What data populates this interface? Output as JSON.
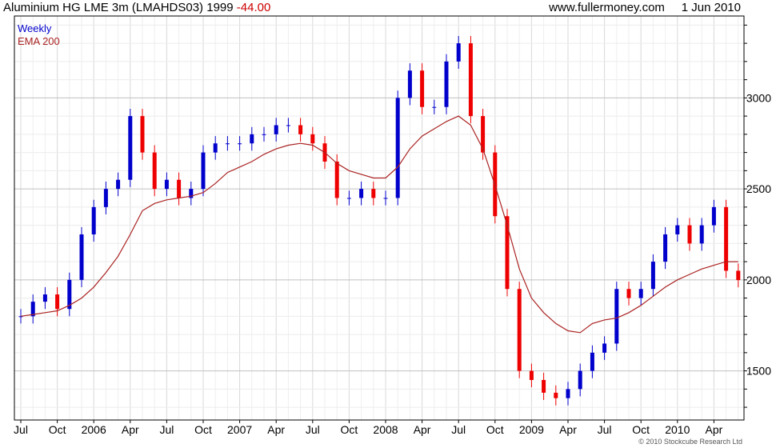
{
  "header": {
    "title": "Aluminium HG LME 3m (LMAHDS03)",
    "last_price": "1999",
    "change": "-44.00",
    "website": "www.fullermoney.com",
    "date": "1 Jun 2010"
  },
  "copyright": "© 2010 Stockcube Research Ltd",
  "colors": {
    "up": "#0000cc",
    "down": "#ee0000",
    "ema": "#aa2222",
    "grid": "#d8d8d8",
    "legend_weekly": "#0000cc",
    "legend_ema": "#aa2222"
  },
  "chart_data": {
    "type": "candlestick",
    "title": "Aluminium HG LME 3m (LMAHDS03)",
    "frequency": "Weekly",
    "ylim": [
      1230,
      3450
    ],
    "y_ticks": [
      1500,
      2000,
      2500,
      3000
    ],
    "x_tick_labels": [
      "Jul",
      "Oct",
      "2006",
      "Apr",
      "Jul",
      "Oct",
      "2007",
      "Apr",
      "Jul",
      "Oct",
      "2008",
      "Apr",
      "Jul",
      "Oct",
      "2009",
      "Apr",
      "Jul",
      "Oct",
      "2010",
      "Apr"
    ],
    "grid": true,
    "legend": {
      "position": "top-left",
      "entries": [
        "Weekly",
        "EMA 200"
      ]
    },
    "series": [
      {
        "name": "Weekly",
        "kind": "close",
        "x": [
          "2005-07",
          "2005-08",
          "2005-09",
          "2005-10",
          "2005-11",
          "2005-12",
          "2006-01",
          "2006-02",
          "2006-03",
          "2006-04",
          "2006-05",
          "2006-06",
          "2006-07",
          "2006-08",
          "2006-09",
          "2006-10",
          "2006-11",
          "2006-12",
          "2007-01",
          "2007-02",
          "2007-03",
          "2007-04",
          "2007-05",
          "2007-06",
          "2007-07",
          "2007-08",
          "2007-09",
          "2007-10",
          "2007-11",
          "2007-12",
          "2008-01",
          "2008-02",
          "2008-03",
          "2008-04",
          "2008-05",
          "2008-06",
          "2008-07",
          "2008-08",
          "2008-09",
          "2008-10",
          "2008-11",
          "2008-12",
          "2009-01",
          "2009-02",
          "2009-03",
          "2009-04",
          "2009-05",
          "2009-06",
          "2009-07",
          "2009-08",
          "2009-09",
          "2009-10",
          "2009-11",
          "2009-12",
          "2010-01",
          "2010-02",
          "2010-03",
          "2010-04",
          "2010-05",
          "2010-06"
        ],
        "values": [
          1800,
          1880,
          1920,
          1840,
          2000,
          2250,
          2400,
          2500,
          2550,
          2900,
          2700,
          2500,
          2550,
          2450,
          2500,
          2700,
          2750,
          2750,
          2750,
          2800,
          2800,
          2850,
          2850,
          2800,
          2750,
          2650,
          2450,
          2450,
          2500,
          2450,
          2450,
          3000,
          3150,
          2950,
          2950,
          3200,
          3300,
          2900,
          2700,
          2350,
          1950,
          1500,
          1450,
          1380,
          1350,
          1400,
          1500,
          1600,
          1650,
          1950,
          1900,
          1950,
          2100,
          2250,
          2300,
          2200,
          2300,
          2400,
          2050,
          1999
        ]
      },
      {
        "name": "EMA 200",
        "kind": "line",
        "x": [
          "2005-07",
          "2005-08",
          "2005-09",
          "2005-10",
          "2005-11",
          "2005-12",
          "2006-01",
          "2006-02",
          "2006-03",
          "2006-04",
          "2006-05",
          "2006-06",
          "2006-07",
          "2006-08",
          "2006-09",
          "2006-10",
          "2006-11",
          "2006-12",
          "2007-01",
          "2007-02",
          "2007-03",
          "2007-04",
          "2007-05",
          "2007-06",
          "2007-07",
          "2007-08",
          "2007-09",
          "2007-10",
          "2007-11",
          "2007-12",
          "2008-01",
          "2008-02",
          "2008-03",
          "2008-04",
          "2008-05",
          "2008-06",
          "2008-07",
          "2008-08",
          "2008-09",
          "2008-10",
          "2008-11",
          "2008-12",
          "2009-01",
          "2009-02",
          "2009-03",
          "2009-04",
          "2009-05",
          "2009-06",
          "2009-07",
          "2009-08",
          "2009-09",
          "2009-10",
          "2009-11",
          "2009-12",
          "2010-01",
          "2010-02",
          "2010-03",
          "2010-04",
          "2010-05",
          "2010-06"
        ],
        "values": [
          1800,
          1810,
          1820,
          1830,
          1860,
          1900,
          1960,
          2040,
          2130,
          2250,
          2380,
          2420,
          2440,
          2450,
          2460,
          2480,
          2530,
          2590,
          2620,
          2650,
          2690,
          2720,
          2740,
          2750,
          2740,
          2700,
          2640,
          2600,
          2580,
          2560,
          2560,
          2620,
          2720,
          2790,
          2830,
          2870,
          2900,
          2850,
          2720,
          2520,
          2300,
          2060,
          1900,
          1820,
          1760,
          1720,
          1710,
          1760,
          1780,
          1790,
          1820,
          1860,
          1910,
          1960,
          2000,
          2030,
          2060,
          2080,
          2100,
          2100
        ]
      }
    ]
  }
}
